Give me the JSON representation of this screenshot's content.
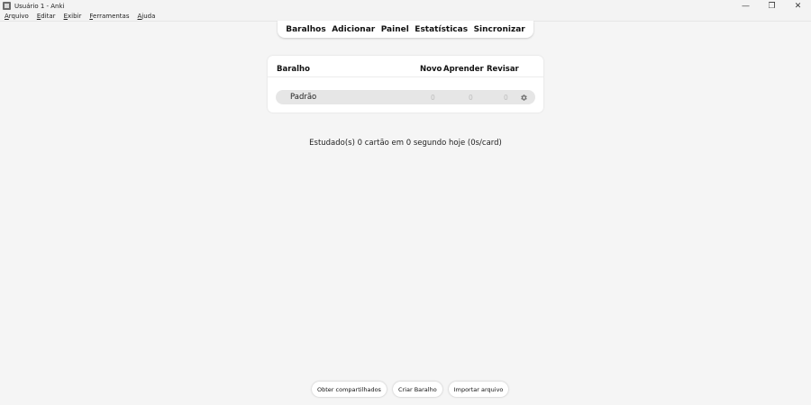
{
  "window": {
    "title": "Usuário 1 - Anki",
    "controls": {
      "minimize": "—",
      "restore": "❐",
      "close": "✕"
    }
  },
  "menu": {
    "items": [
      {
        "first": "A",
        "rest": "rquivo"
      },
      {
        "first": "E",
        "rest": "ditar"
      },
      {
        "first": "E",
        "rest": "xibir"
      },
      {
        "first": "F",
        "rest": "erramentas"
      },
      {
        "first": "A",
        "rest": "juda"
      }
    ]
  },
  "toolbar": {
    "decks": "Baralhos",
    "add": "Adicionar",
    "browse": "Painel",
    "stats": "Estatísticas",
    "sync": "Sincronizar"
  },
  "deck_table": {
    "headers": {
      "deck": "Baralho",
      "new": "Novo",
      "learn": "Aprender",
      "review": "Revisar"
    },
    "rows": [
      {
        "name": "Padrão",
        "new": "0",
        "learn": "0",
        "review": "0",
        "icon": "gear-icon"
      }
    ]
  },
  "stats_text": "Estudado(s) 0 cartão em 0 segundo hoje (0s/card)",
  "bottom_buttons": {
    "shared": "Obter compartilhados",
    "create": "Criar Baralho",
    "import": "Importar arquivo"
  },
  "colors": {
    "background": "#f5f5f5",
    "panel": "#ffffff",
    "row": "#e6e6e6",
    "count_zero": "#bdbdbd"
  }
}
